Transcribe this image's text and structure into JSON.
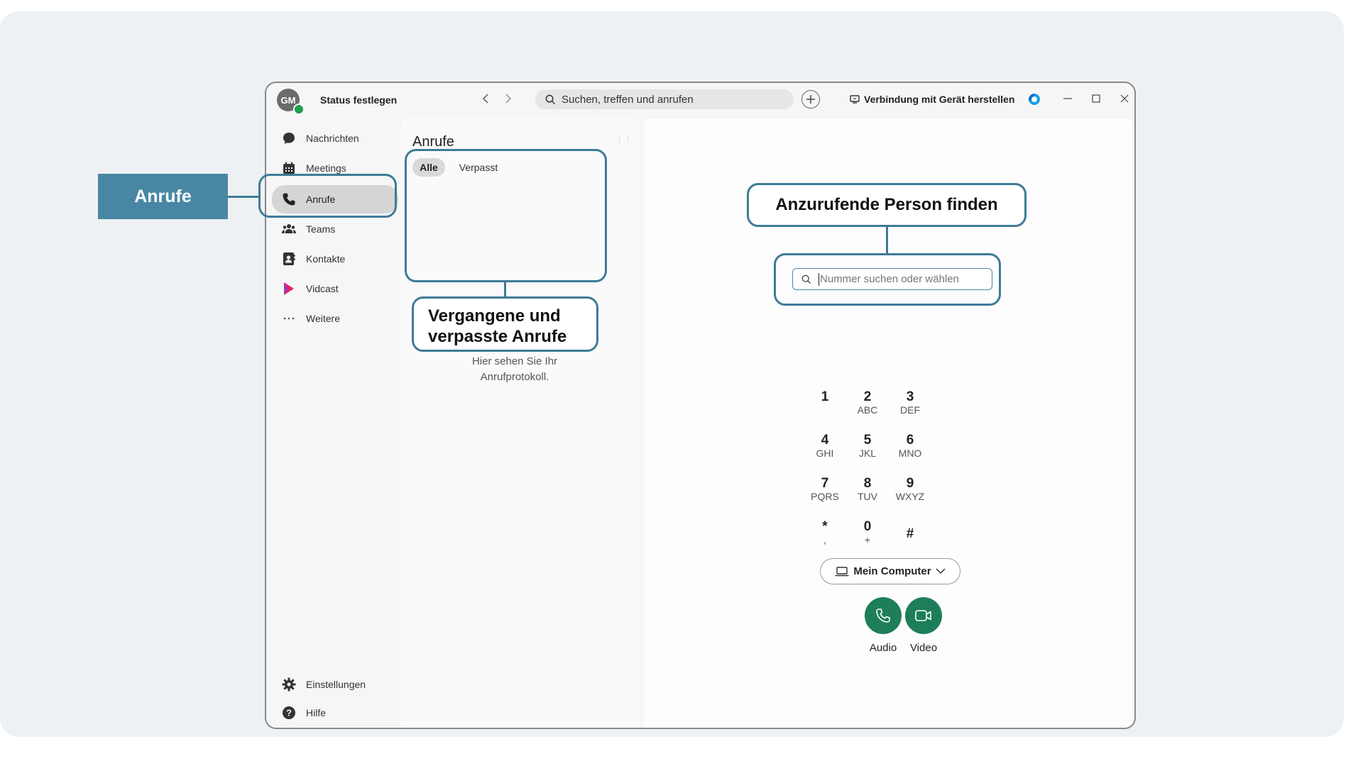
{
  "titlebar": {
    "avatar_initials": "GM",
    "status": "Status festlegen",
    "search_placeholder": "Suchen, treffen und anrufen",
    "connect_device": "Verbindung mit Gerät herstellen"
  },
  "sidebar": {
    "items": [
      {
        "label": "Nachrichten",
        "icon": "chat-icon"
      },
      {
        "label": "Meetings",
        "icon": "calendar-icon"
      },
      {
        "label": "Anrufe",
        "icon": "phone-icon",
        "active": true
      },
      {
        "label": "Teams",
        "icon": "people-icon"
      },
      {
        "label": "Kontakte",
        "icon": "contacts-icon"
      },
      {
        "label": "Vidcast",
        "icon": "vidcast-icon"
      },
      {
        "label": "Weitere",
        "icon": "more-icon"
      }
    ],
    "bottom": [
      {
        "label": "Einstellungen",
        "icon": "gear-icon"
      },
      {
        "label": "Hilfe",
        "icon": "help-icon"
      }
    ]
  },
  "calls_panel": {
    "title": "Anrufe",
    "filters": [
      "Alle",
      "Verpasst"
    ],
    "empty_line1": "Hier sehen Sie Ihr",
    "empty_line2": "Anrufprotokoll."
  },
  "dialer": {
    "input_placeholder": "Nummer suchen oder wählen",
    "keys": [
      {
        "digit": "1",
        "letters": ""
      },
      {
        "digit": "2",
        "letters": "ABC"
      },
      {
        "digit": "3",
        "letters": "DEF"
      },
      {
        "digit": "4",
        "letters": "GHI"
      },
      {
        "digit": "5",
        "letters": "JKL"
      },
      {
        "digit": "6",
        "letters": "MNO"
      },
      {
        "digit": "7",
        "letters": "PQRS"
      },
      {
        "digit": "8",
        "letters": "TUV"
      },
      {
        "digit": "9",
        "letters": "WXYZ"
      },
      {
        "digit": "*",
        "letters": ","
      },
      {
        "digit": "0",
        "letters": "+"
      },
      {
        "digit": "#",
        "letters": ""
      }
    ],
    "device": "Mein Computer",
    "audio_label": "Audio",
    "video_label": "Video"
  },
  "annotations": {
    "tag_calls": "Anrufe",
    "find_person": "Anzurufende Person finden",
    "history_line1": "Vergangene und",
    "history_line2": "verpasste Anrufe"
  },
  "colors": {
    "annotation": "#3e7b98",
    "tag_bg": "#4787a3",
    "call_green": "#1e7e5a",
    "presence_green": "#1f9e4f"
  }
}
